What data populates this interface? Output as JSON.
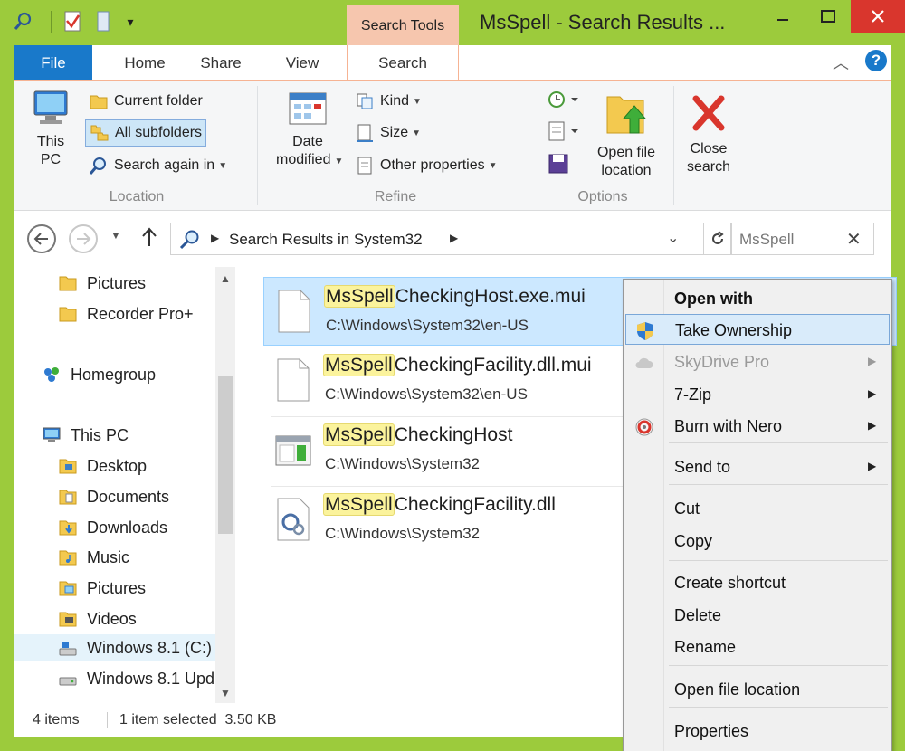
{
  "window": {
    "title": "MsSpell - Search Results ...",
    "contextual_tab": "Search Tools",
    "controls": {
      "minimize": "—",
      "maximize": "☐",
      "close": "✕"
    }
  },
  "ribbon": {
    "tabs": [
      "File",
      "Home",
      "Share",
      "View",
      "Search"
    ],
    "active_tab": "Search",
    "groups": {
      "location": {
        "label": "Location",
        "this_pc": "This PC",
        "current_folder": "Current folder",
        "all_subfolders": "All subfolders",
        "search_again_in": "Search again in"
      },
      "refine": {
        "label": "Refine",
        "date_modified": "Date modified",
        "kind": "Kind",
        "size": "Size",
        "other_properties": "Other properties"
      },
      "options": {
        "label": "Options",
        "open_file_location": "Open file location",
        "close_search": "Close search"
      }
    }
  },
  "address": {
    "path": "Search Results in System32",
    "search_value": "MsSpell"
  },
  "nav_pane": {
    "items": [
      {
        "label": "Pictures",
        "icon": "folder-icon"
      },
      {
        "label": "Recorder Pro+",
        "icon": "folder-icon"
      },
      {
        "label": "Homegroup",
        "icon": "homegroup-icon"
      },
      {
        "label": "This PC",
        "icon": "computer-icon"
      },
      {
        "label": "Desktop",
        "icon": "folder-icon"
      },
      {
        "label": "Documents",
        "icon": "folder-icon"
      },
      {
        "label": "Downloads",
        "icon": "folder-icon"
      },
      {
        "label": "Music",
        "icon": "folder-icon"
      },
      {
        "label": "Pictures",
        "icon": "folder-icon"
      },
      {
        "label": "Videos",
        "icon": "folder-icon"
      },
      {
        "label": "Windows 8.1 (C:)",
        "icon": "drive-icon"
      },
      {
        "label": "Windows 8.1 Upd",
        "icon": "drive-icon"
      }
    ]
  },
  "results": [
    {
      "highlight": "MsSpell",
      "rest": "CheckingHost.exe.mui",
      "path": "C:\\Windows\\System32\\en-US",
      "icon": "file-icon",
      "selected": true
    },
    {
      "highlight": "MsSpell",
      "rest": "CheckingFacility.dll.mui",
      "path": "C:\\Windows\\System32\\en-US",
      "icon": "file-icon",
      "selected": false
    },
    {
      "highlight": "MsSpell",
      "rest": "CheckingHost",
      "path": "C:\\Windows\\System32",
      "icon": "exe-icon",
      "selected": false
    },
    {
      "highlight": "MsSpell",
      "rest": "CheckingFacility.dll",
      "path": "C:\\Windows\\System32",
      "icon": "dll-icon",
      "selected": false
    }
  ],
  "status": {
    "count": "4 items",
    "selection": "1 item selected  3.50 KB"
  },
  "context_menu": {
    "items": [
      {
        "label": "Open with",
        "bold": true
      },
      {
        "label": "Take Ownership",
        "icon": "shield-icon",
        "hover": true
      },
      {
        "label": "SkyDrive Pro",
        "icon": "cloud-icon",
        "disabled": true,
        "submenu": true
      },
      {
        "label": "7-Zip",
        "submenu": true
      },
      {
        "label": "Burn with Nero",
        "icon": "nero-icon",
        "submenu": true
      },
      {
        "label": "Send to",
        "submenu": true
      },
      {
        "label": "Cut"
      },
      {
        "label": "Copy"
      },
      {
        "label": "Create shortcut"
      },
      {
        "label": "Delete"
      },
      {
        "label": "Rename"
      },
      {
        "label": "Open file location"
      },
      {
        "label": "Properties"
      }
    ]
  }
}
